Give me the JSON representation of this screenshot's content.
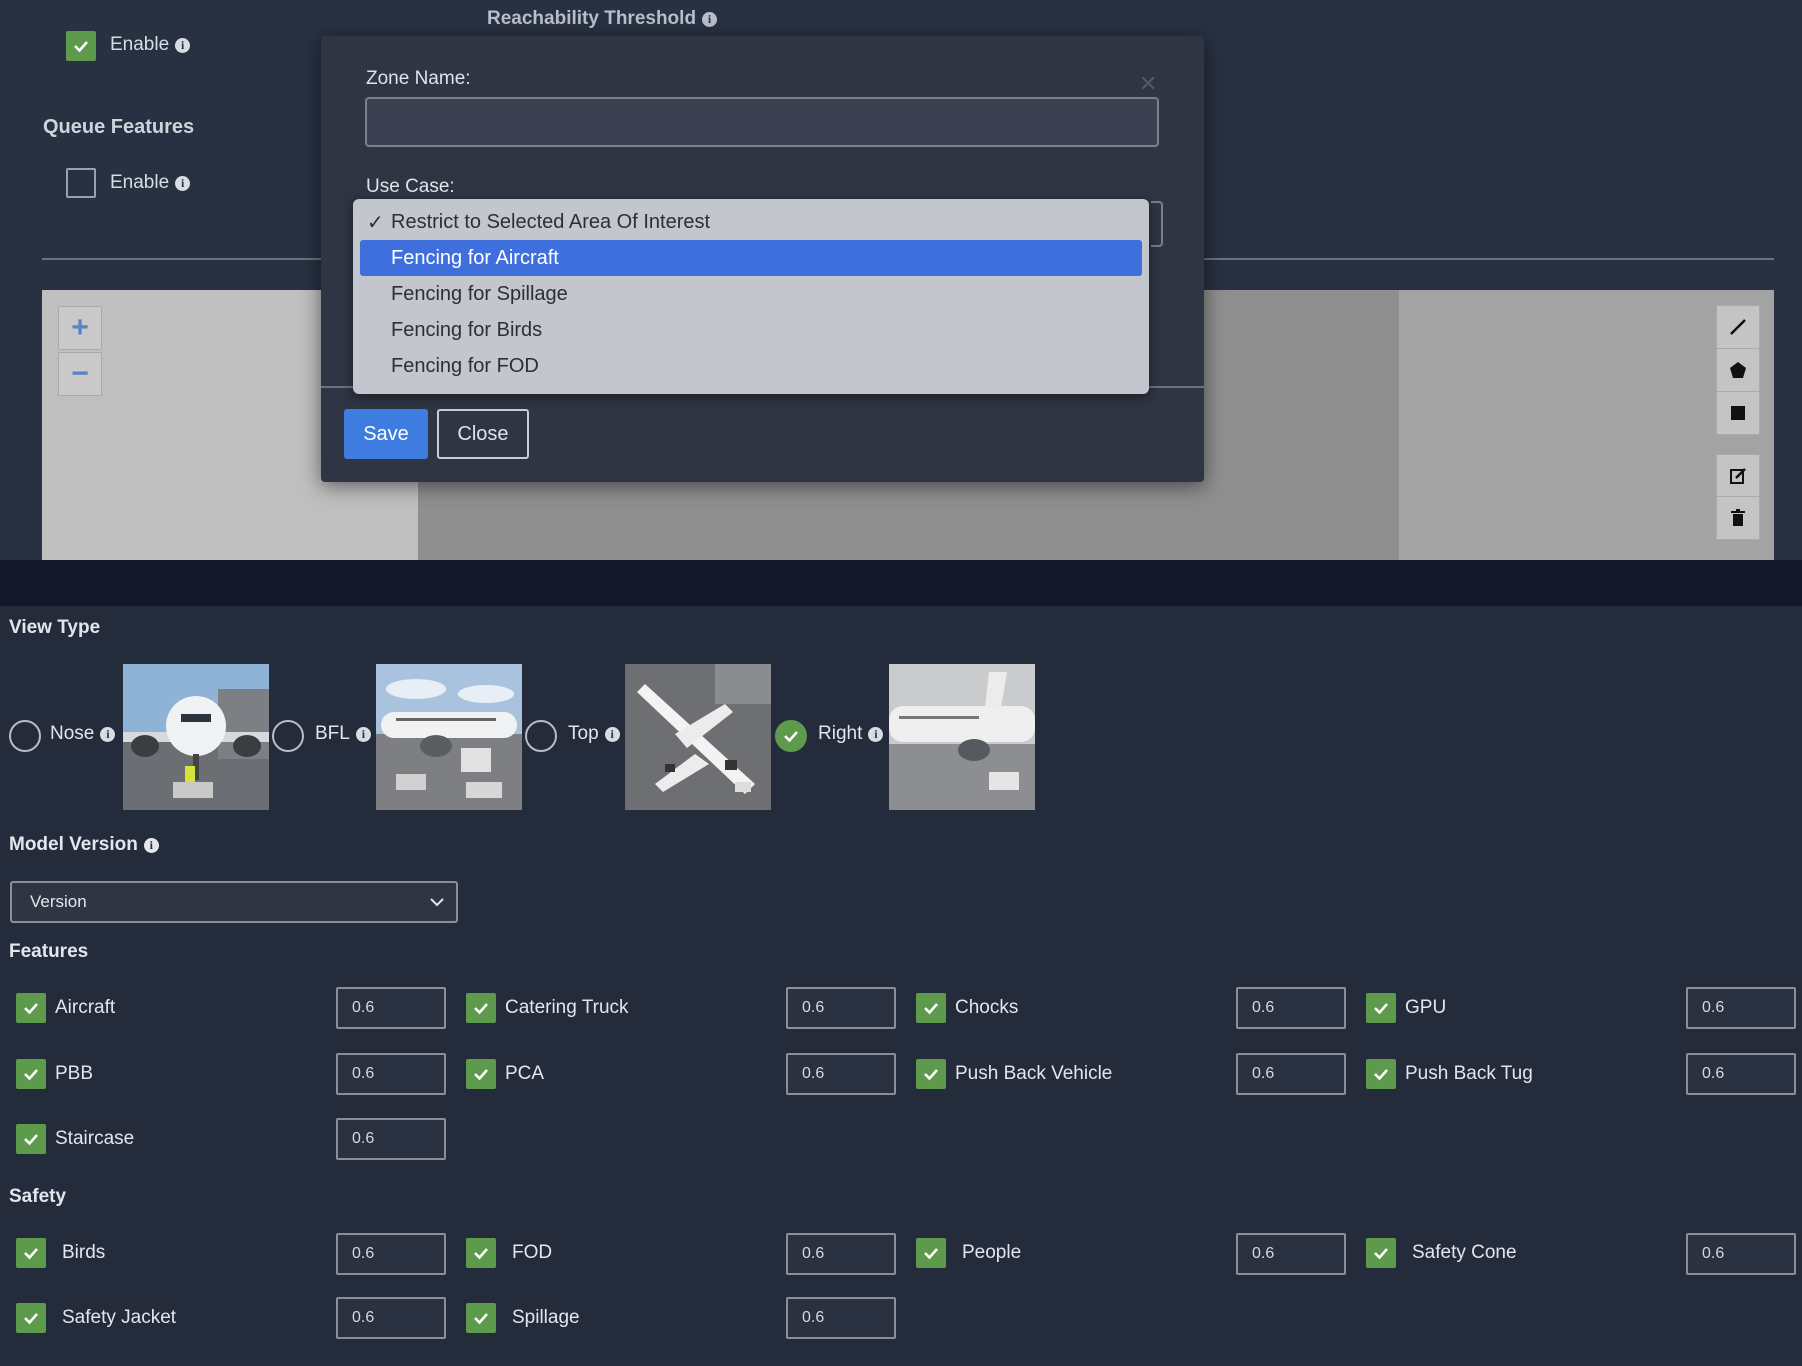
{
  "top": {
    "enable_label": "Enable",
    "enable_checked": true,
    "queue_features_heading": "Queue Features",
    "queue_enable_label": "Enable",
    "queue_enable_checked": false,
    "reachability_title": "Reachability Threshold"
  },
  "modal": {
    "zone_name_label": "Zone Name:",
    "zone_name_value": "",
    "use_case_label": "Use Case:",
    "use_case_options": [
      {
        "label": "Restrict to Selected Area Of Interest",
        "checked": true,
        "highlighted": false
      },
      {
        "label": "Fencing for Aircraft",
        "checked": false,
        "highlighted": true
      },
      {
        "label": "Fencing for Spillage",
        "checked": false,
        "highlighted": false
      },
      {
        "label": "Fencing for Birds",
        "checked": false,
        "highlighted": false
      },
      {
        "label": "Fencing for FOD",
        "checked": false,
        "highlighted": false
      }
    ],
    "save_label": "Save",
    "close_label": "Close"
  },
  "map": {
    "zoom_in": "+",
    "zoom_out": "−"
  },
  "view_type": {
    "heading": "View Type",
    "options": [
      {
        "label": "Nose",
        "selected": false
      },
      {
        "label": "BFL",
        "selected": false
      },
      {
        "label": "Top",
        "selected": false
      },
      {
        "label": "Right",
        "selected": true
      }
    ]
  },
  "model_version": {
    "heading": "Model Version",
    "selected": "Version"
  },
  "features": {
    "heading": "Features",
    "items": [
      {
        "label": "Aircraft",
        "value": "0.6",
        "checked": true
      },
      {
        "label": "Catering Truck",
        "value": "0.6",
        "checked": true
      },
      {
        "label": "Chocks",
        "value": "0.6",
        "checked": true
      },
      {
        "label": "GPU",
        "value": "0.6",
        "checked": true
      },
      {
        "label": "PBB",
        "value": "0.6",
        "checked": true
      },
      {
        "label": "PCA",
        "value": "0.6",
        "checked": true
      },
      {
        "label": "Push Back Vehicle",
        "value": "0.6",
        "checked": true
      },
      {
        "label": "Push Back Tug",
        "value": "0.6",
        "checked": true
      },
      {
        "label": "Staircase",
        "value": "0.6",
        "checked": true
      }
    ]
  },
  "safety": {
    "heading": "Safety",
    "items": [
      {
        "label": "Birds",
        "value": "0.6",
        "checked": true
      },
      {
        "label": "FOD",
        "value": "0.6",
        "checked": true
      },
      {
        "label": "People",
        "value": "0.6",
        "checked": true
      },
      {
        "label": "Safety Cone",
        "value": "0.6",
        "checked": true
      },
      {
        "label": "Safety Jacket",
        "value": "0.6",
        "checked": true
      },
      {
        "label": "Spillage",
        "value": "0.6",
        "checked": true
      }
    ]
  },
  "colors": {
    "check_green": "#5e9a4c",
    "accent_blue": "#3f7ce0",
    "panel_bg": "#242b3b"
  }
}
